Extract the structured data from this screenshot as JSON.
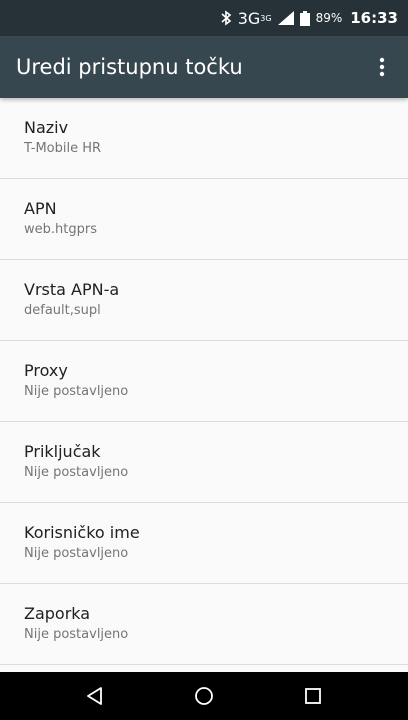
{
  "status_bar": {
    "bluetooth_icon": "bluetooth-icon",
    "network_type": "3G",
    "network_sup": "3G",
    "signal_icon": "signal-icon",
    "battery_icon": "battery-icon",
    "battery_percent": "89%",
    "time": "16:33"
  },
  "app_bar": {
    "title": "Uredi pristupnu točku",
    "overflow_icon": "more-vert-icon"
  },
  "apn_settings": {
    "items": [
      {
        "label": "Naziv",
        "value": "T-Mobile HR"
      },
      {
        "label": "APN",
        "value": "web.htgprs"
      },
      {
        "label": "Vrsta APN-a",
        "value": "default,supl"
      },
      {
        "label": "Proxy",
        "value": "Nije postavljeno"
      },
      {
        "label": "Priključak",
        "value": "Nije postavljeno"
      },
      {
        "label": "Korisničko ime",
        "value": "Nije postavljeno"
      },
      {
        "label": "Zaporka",
        "value": "Nije postavljeno"
      }
    ]
  },
  "nav_bar": {
    "back_icon": "back-triangle-icon",
    "home_icon": "home-circle-icon",
    "recents_icon": "recents-square-icon"
  },
  "colors": {
    "status_bar_bg": "#263238",
    "app_bar_bg": "#37474f",
    "list_bg": "#fafafa",
    "title_text": "#212121",
    "value_text": "#757575",
    "nav_bar_bg": "#000000"
  }
}
